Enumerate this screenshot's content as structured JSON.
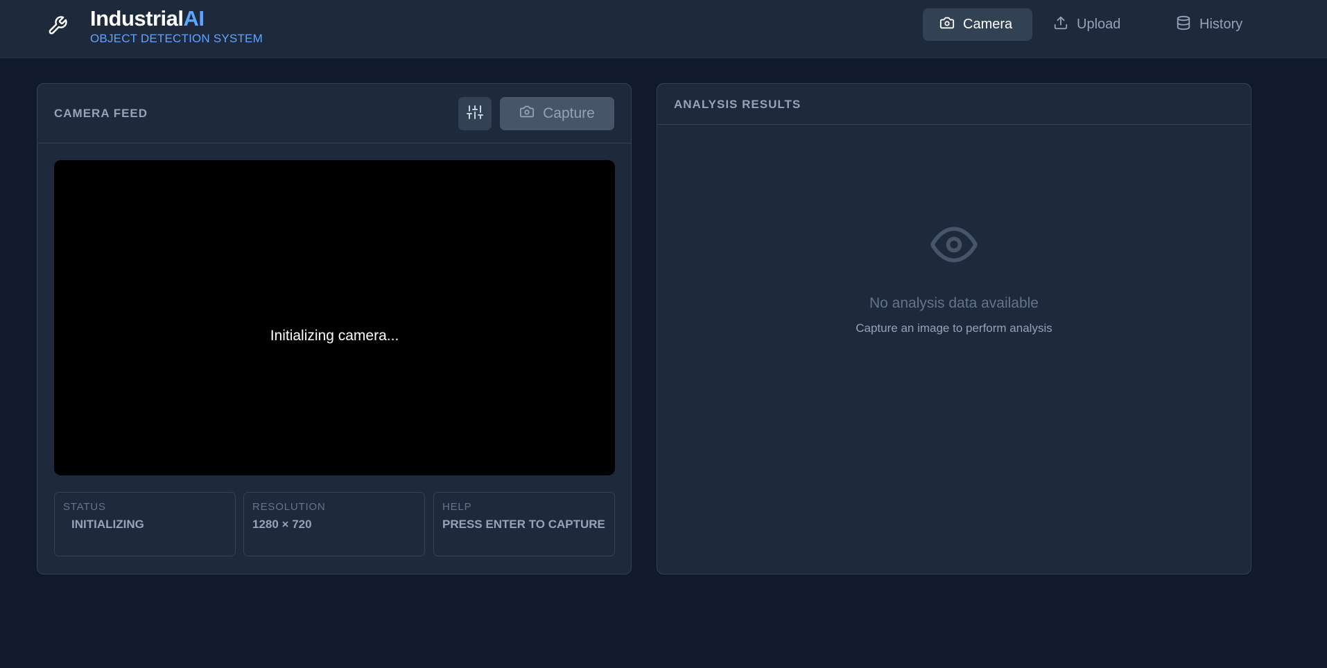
{
  "header": {
    "brand_main": "Industrial",
    "brand_accent": "AI",
    "subtitle": "OBJECT DETECTION SYSTEM",
    "logo_icon": "wrench-icon"
  },
  "nav": {
    "items": [
      {
        "label": "Camera",
        "icon": "camera-icon",
        "active": true
      },
      {
        "label": "Upload",
        "icon": "upload-icon",
        "active": false
      },
      {
        "label": "History",
        "icon": "database-icon",
        "active": false
      }
    ]
  },
  "camera_panel": {
    "title": "CAMERA FEED",
    "settings_icon": "sliders-icon",
    "capture_label": "Capture",
    "video_status": "Initializing camera...",
    "info": [
      {
        "label": "STATUS",
        "value": "INITIALIZING"
      },
      {
        "label": "RESOLUTION",
        "value": "1280 × 720"
      },
      {
        "label": "HELP",
        "value": "PRESS ENTER TO CAPTURE"
      }
    ]
  },
  "results_panel": {
    "title": "ANALYSIS RESULTS",
    "empty_icon": "eye-icon",
    "empty_title": "No analysis data available",
    "empty_subtitle": "Capture an image to perform analysis"
  },
  "colors": {
    "background": "#111a2c",
    "surface": "#1e293b",
    "accent": "#60a5fa",
    "border": "#334155"
  }
}
